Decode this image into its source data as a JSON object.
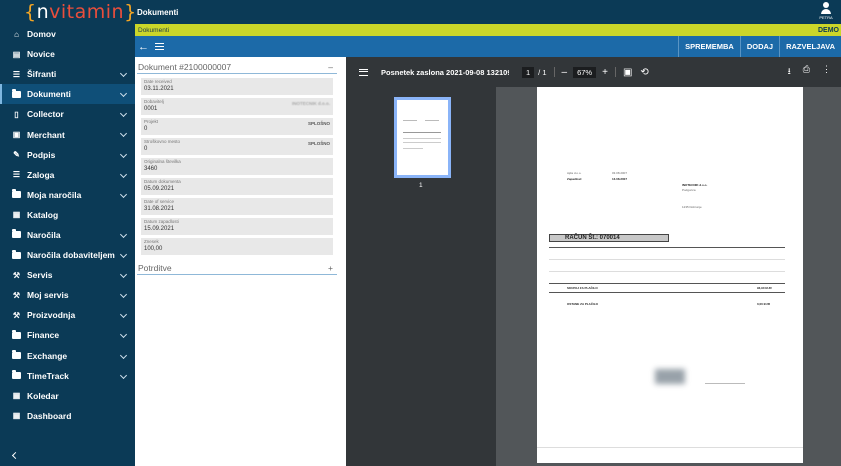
{
  "app": {
    "logo_brace_open": "{",
    "logo_n": "n",
    "logo_vi": "vitamin",
    "logo_brace_close": "}"
  },
  "topbar": {
    "title": "Dokumenti",
    "user_name": "PETRA"
  },
  "breadcrumb": {
    "path": "Dokumenti",
    "env": "DEMO"
  },
  "actions": {
    "buttons": [
      "SPREMEMBA",
      "DODAJ",
      "RAZVELJAVA"
    ]
  },
  "sidebar": {
    "items": [
      {
        "label": "Domov",
        "icon": "home-icon",
        "caret": false
      },
      {
        "label": "Novice",
        "icon": "news-icon",
        "caret": false
      },
      {
        "label": "Šifranti",
        "icon": "list-icon",
        "caret": true
      },
      {
        "label": "Dokumenti",
        "icon": "folder-icon",
        "caret": true,
        "active": true
      },
      {
        "label": "Collector",
        "icon": "phone-icon",
        "caret": true
      },
      {
        "label": "Merchant",
        "icon": "briefcase-icon",
        "caret": true
      },
      {
        "label": "Podpis",
        "icon": "signature-icon",
        "caret": true
      },
      {
        "label": "Zaloga",
        "icon": "stock-icon",
        "caret": true
      },
      {
        "label": "Moja naročila",
        "icon": "folder-icon",
        "caret": true
      },
      {
        "label": "Katalog",
        "icon": "catalog-icon",
        "caret": false
      },
      {
        "label": "Naročila",
        "icon": "folder-icon",
        "caret": true
      },
      {
        "label": "Naročila dobaviteljem",
        "icon": "folder-icon",
        "caret": true
      },
      {
        "label": "Servis",
        "icon": "wrench-icon",
        "caret": true
      },
      {
        "label": "Moj servis",
        "icon": "wrench-icon",
        "caret": true
      },
      {
        "label": "Proizvodnja",
        "icon": "tools-icon",
        "caret": true
      },
      {
        "label": "Finance",
        "icon": "folder-icon",
        "caret": true
      },
      {
        "label": "Exchange",
        "icon": "folder-icon",
        "caret": true
      },
      {
        "label": "TimeTrack",
        "icon": "folder-icon",
        "caret": true
      },
      {
        "label": "Koledar",
        "icon": "calendar-icon",
        "caret": false
      },
      {
        "label": "Dashboard",
        "icon": "dashboard-icon",
        "caret": false
      }
    ]
  },
  "form": {
    "title": "Dokument #2100000007",
    "fields": [
      {
        "label": "Date received",
        "value": "03.11.2021",
        "right": ""
      },
      {
        "label": "Dobavitelj",
        "value": "0001",
        "right": "INOTECNIK d.o.o."
      },
      {
        "label": "Projekt",
        "value": "0",
        "right": "SPLOŠNO"
      },
      {
        "label": "Stroškovno mesto",
        "value": "0",
        "right": "SPLOŠNO"
      },
      {
        "label": "Originalna številka",
        "value": "3460",
        "right": ""
      },
      {
        "label": "Datum dokumenta",
        "value": "05.09.2021",
        "right": ""
      },
      {
        "label": "Date of service",
        "value": "31.08.2021",
        "right": ""
      },
      {
        "label": "Datum zapadlosti",
        "value": "15.09.2021",
        "right": ""
      },
      {
        "label": "Znesek",
        "value": "100,00",
        "right": ""
      }
    ],
    "approvals_title": "Potrditve"
  },
  "viewer": {
    "title": "Posnetek zaslona 2021-09-08 132109_...",
    "page_current": "1",
    "page_total": "/ 1",
    "zoom": "67%",
    "thumb_number": "1",
    "invoice_title": "RAČUN Št.: 070014",
    "doc_lines": {
      "h1": "SKUPAJ ZA PLAČILO",
      "h2": "OSTANE ZA PLAČILO",
      "amount1": "93,90 EUR",
      "amount2": "0,00 EUR",
      "zapadlost": "Zapadlost:",
      "zapadlost_date": "13.08.2007"
    }
  }
}
